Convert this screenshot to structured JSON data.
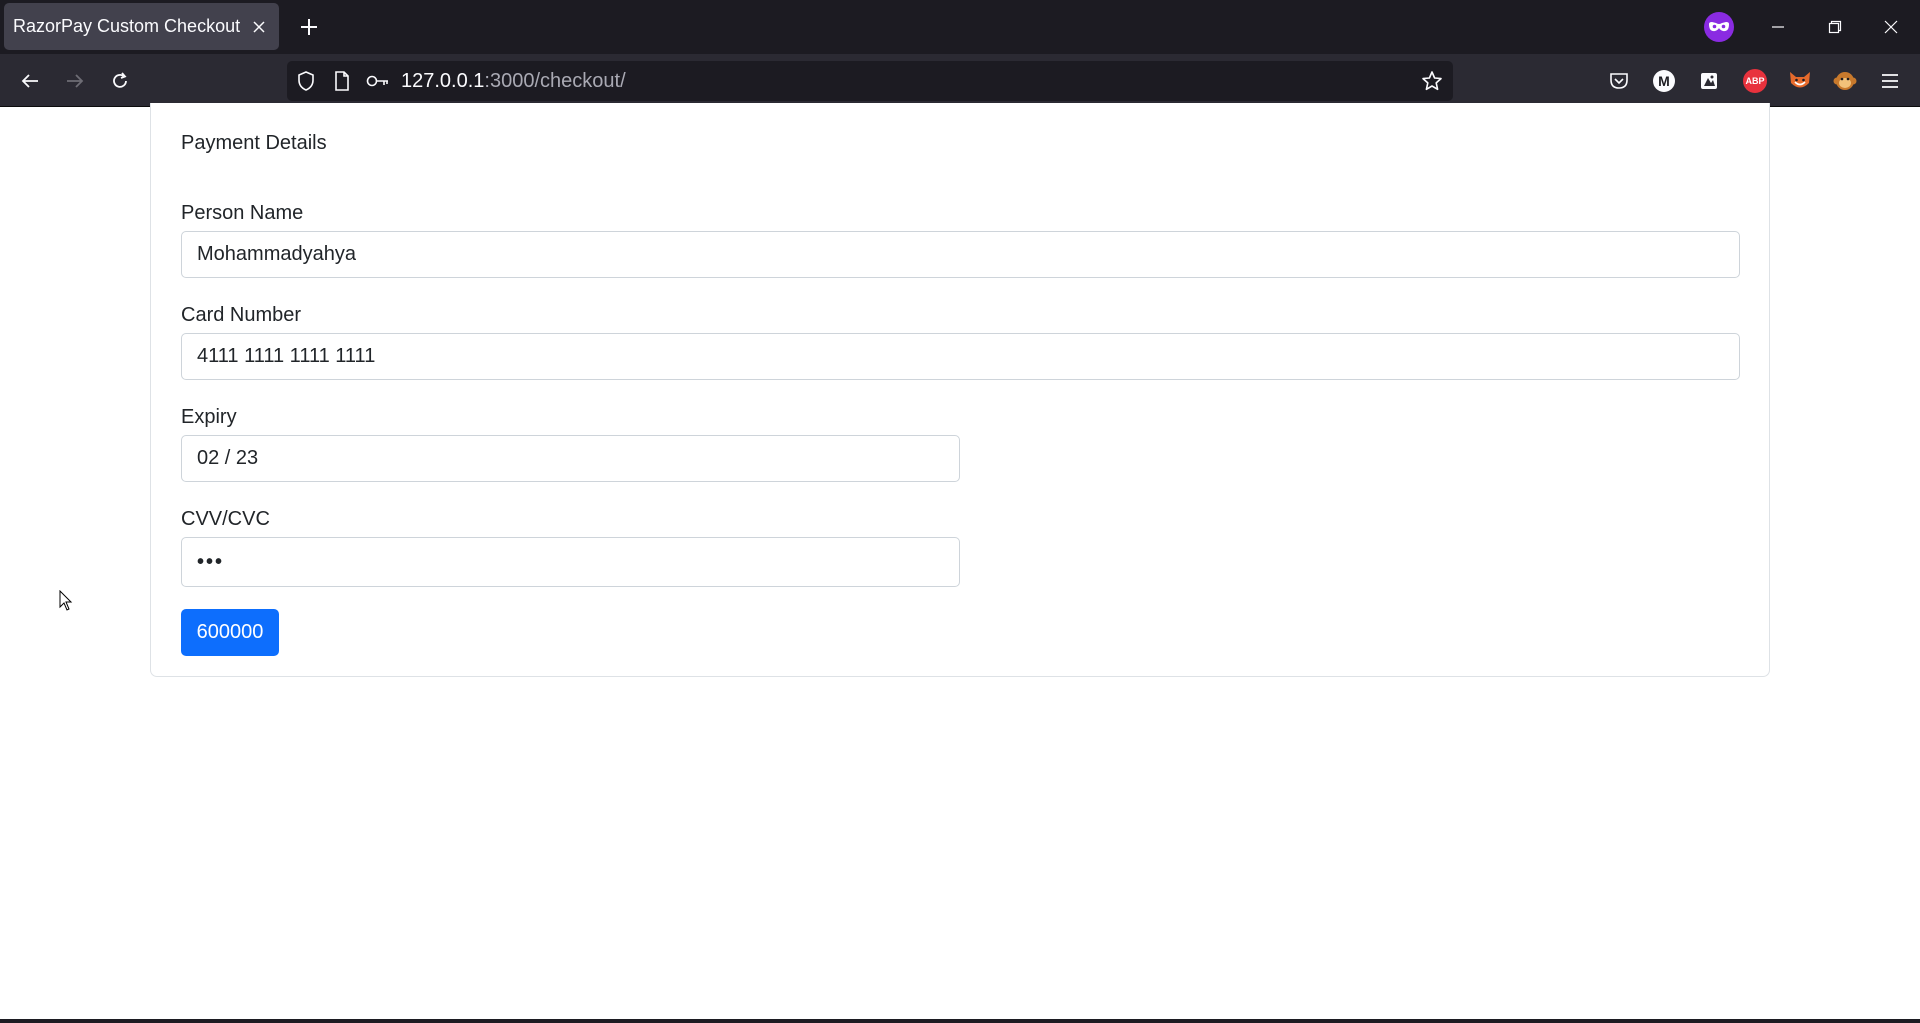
{
  "browser": {
    "tab_title": "RazorPay Custom Checkout",
    "tab_close_icon": "close-icon",
    "new_tab_icon": "plus-icon",
    "url_host": "127.0.0.1",
    "url_rest": ":3000/checkout/",
    "extensions": {
      "m_label": "M",
      "abp_label": "ABP"
    }
  },
  "form": {
    "title": "Payment Details",
    "person_name": {
      "label": "Person Name",
      "value": "Mohammadyahya"
    },
    "card_number": {
      "label": "Card Number",
      "value": "4111 1111 1111 1111"
    },
    "expiry": {
      "label": "Expiry",
      "value": "02 / 23"
    },
    "cvv": {
      "label": "CVV/CVC",
      "value": "•••"
    },
    "pay_button_label": "600000"
  },
  "colors": {
    "primary_button": "#0d6efd",
    "chrome_dark": "#1c1b22",
    "toolbar": "#2b2a33",
    "private_mask": "#8a2be2"
  }
}
